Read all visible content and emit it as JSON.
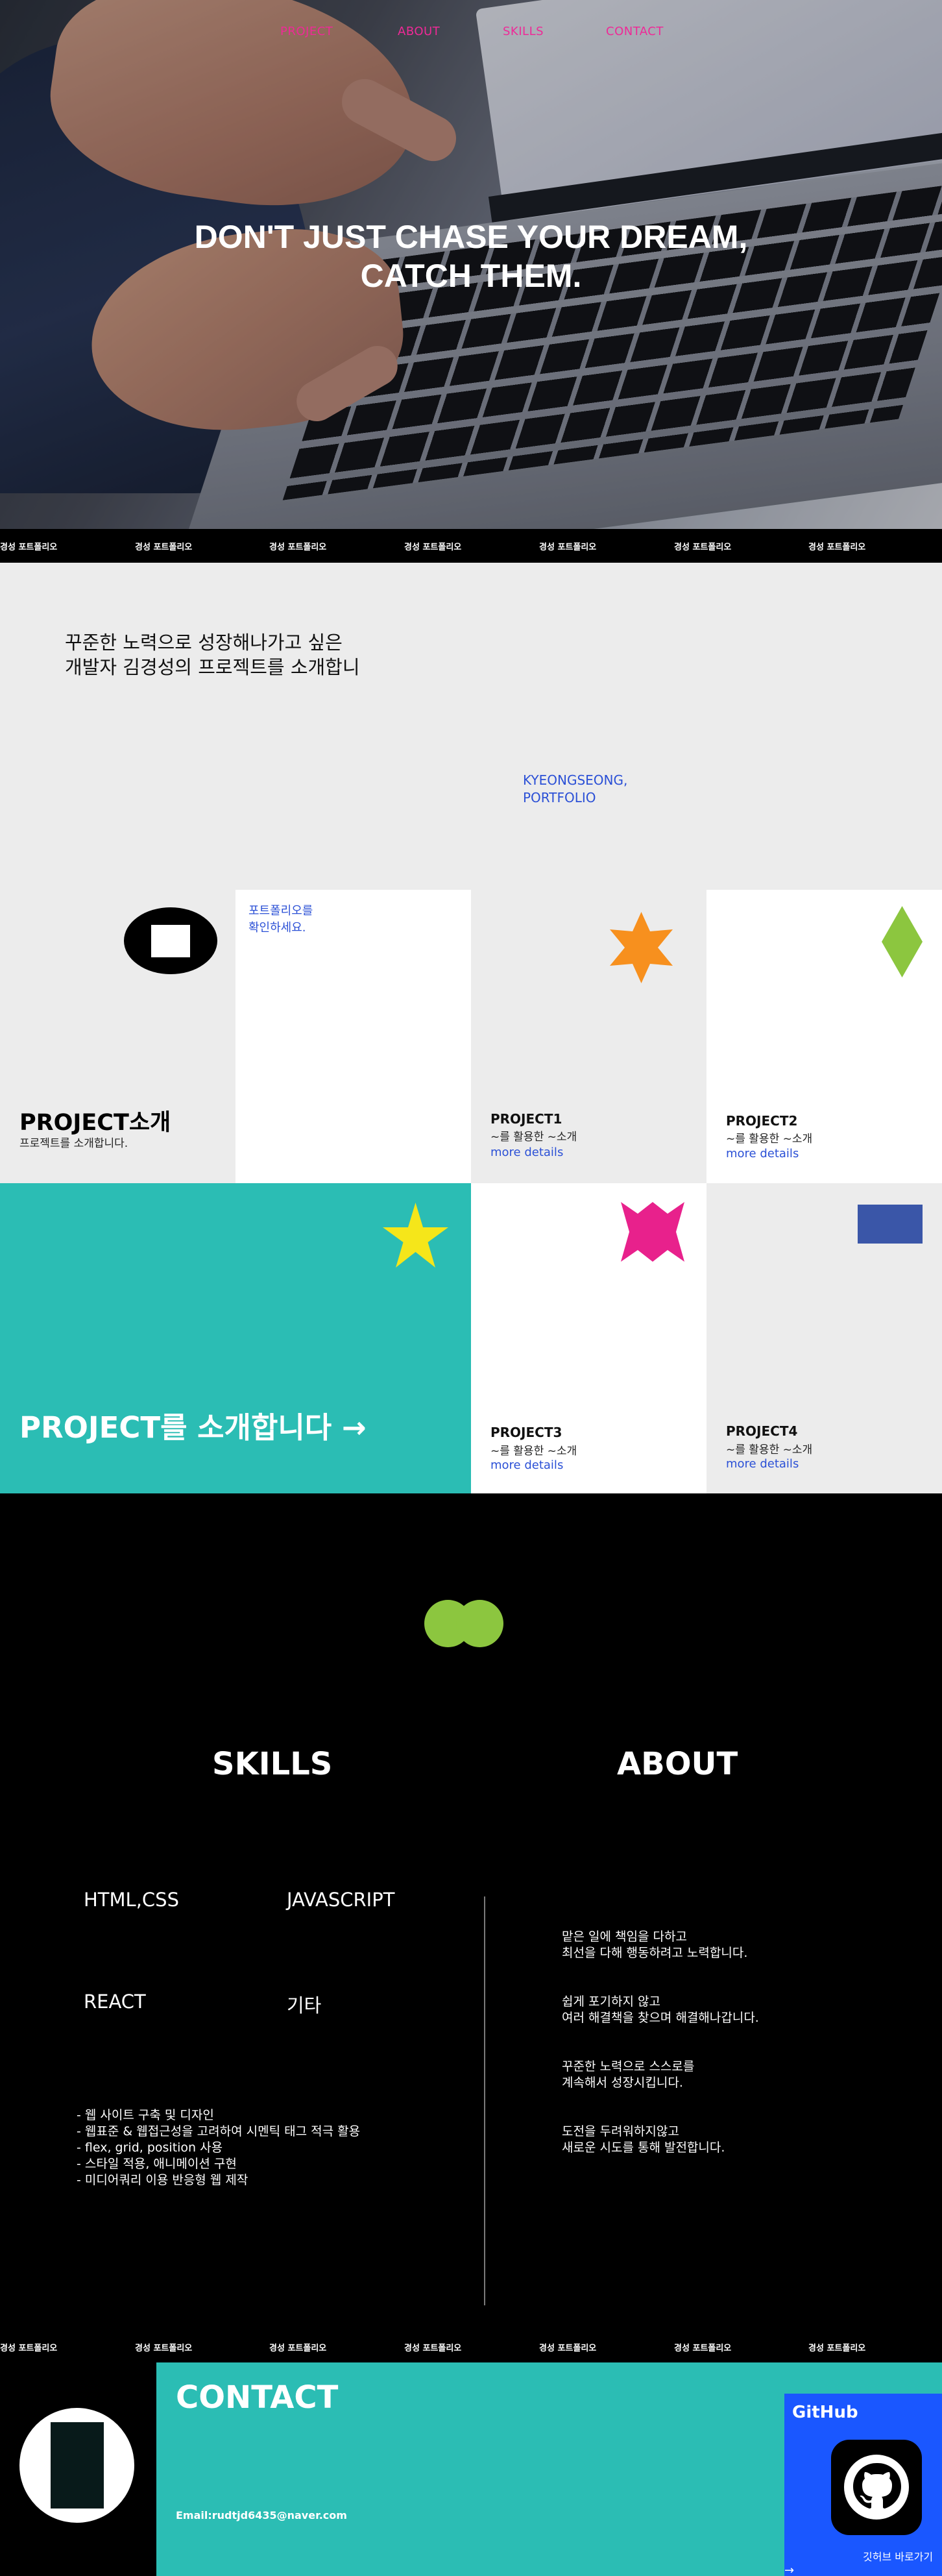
{
  "nav": {
    "items": [
      "PROJECT",
      "ABOUT",
      "SKILLS",
      "CONTACT"
    ]
  },
  "hero": {
    "line1": "DON'T JUST CHASE YOUR DREAM,",
    "line2": "CATCH THEM."
  },
  "marquee": {
    "text": "경성 포트폴리오"
  },
  "intro": {
    "line1": "꾸준한 노력으로 성장해나가고 싶은",
    "line2": "개발자 김경성의 프로젝트를 소개합니",
    "side_line1": "KYEONGSEONG,",
    "side_line2": "PORTFOLIO"
  },
  "projects": {
    "heading": "PROJECT소개",
    "subheading": "프로젝트를 소개합니다.",
    "note_line1": "포트폴리오를",
    "note_line2": "확인하세요.",
    "cta": "PROJECT를 소개합니다 →",
    "items": [
      {
        "title": "PROJECT1",
        "desc": "~를 활용한 ~소개",
        "link": "more details"
      },
      {
        "title": "PROJECT2",
        "desc": "~를 활용한 ~소개",
        "link": "more details"
      },
      {
        "title": "PROJECT3",
        "desc": "~를 활용한 ~소개",
        "link": "more details"
      },
      {
        "title": "PROJECT4",
        "desc": "~를 활용한 ~소개",
        "link": "more details"
      }
    ]
  },
  "skills": {
    "heading": "SKILLS",
    "items": [
      "HTML,CSS",
      "JAVASCRIPT",
      "REACT",
      "기타"
    ],
    "list": [
      "- 웹 사이트 구축 및 디자인",
      "- 웹표준 & 웹접근성을 고려하여 시멘틱 태그 적극 활용",
      "- flex, grid, position 사용",
      "- 스타일 적용, 애니메이션 구현",
      "- 미디어쿼리 이용 반응형 웹 제작"
    ]
  },
  "about": {
    "heading": "ABOUT",
    "items": [
      {
        "l1": "맡은 일에 책임을 다하고",
        "l2": "최선을 다해 행동하려고 노력합니다."
      },
      {
        "l1": "쉽게 포기하지 않고",
        "l2": "여러 해결책을 찾으며 해결해나갑니다."
      },
      {
        "l1": "꾸준한 노력으로 스스로를",
        "l2": "계속해서 성장시킵니다."
      },
      {
        "l1": "도전을 두려워하지않고",
        "l2": "새로운 시도를 통해 발전합니다."
      }
    ]
  },
  "contact": {
    "heading": "CONTACT",
    "email": "Email:rudtjd6435@naver.com",
    "github_title": "GitHub",
    "github_link": "깃허브 바로가기",
    "github_arrow": "→"
  },
  "colors": {
    "nav": "#ee2a97",
    "teal": "#2bbdb4",
    "link_blue": "#2b50d6",
    "github_blue": "#1a57ff",
    "star_orange": "#f7901e",
    "diamond_green": "#8cc63f",
    "star_yellow": "#f5e61a",
    "burst_pink": "#e8218c",
    "rect_blue": "#3a56a8",
    "blob_green": "#8cc63f"
  }
}
